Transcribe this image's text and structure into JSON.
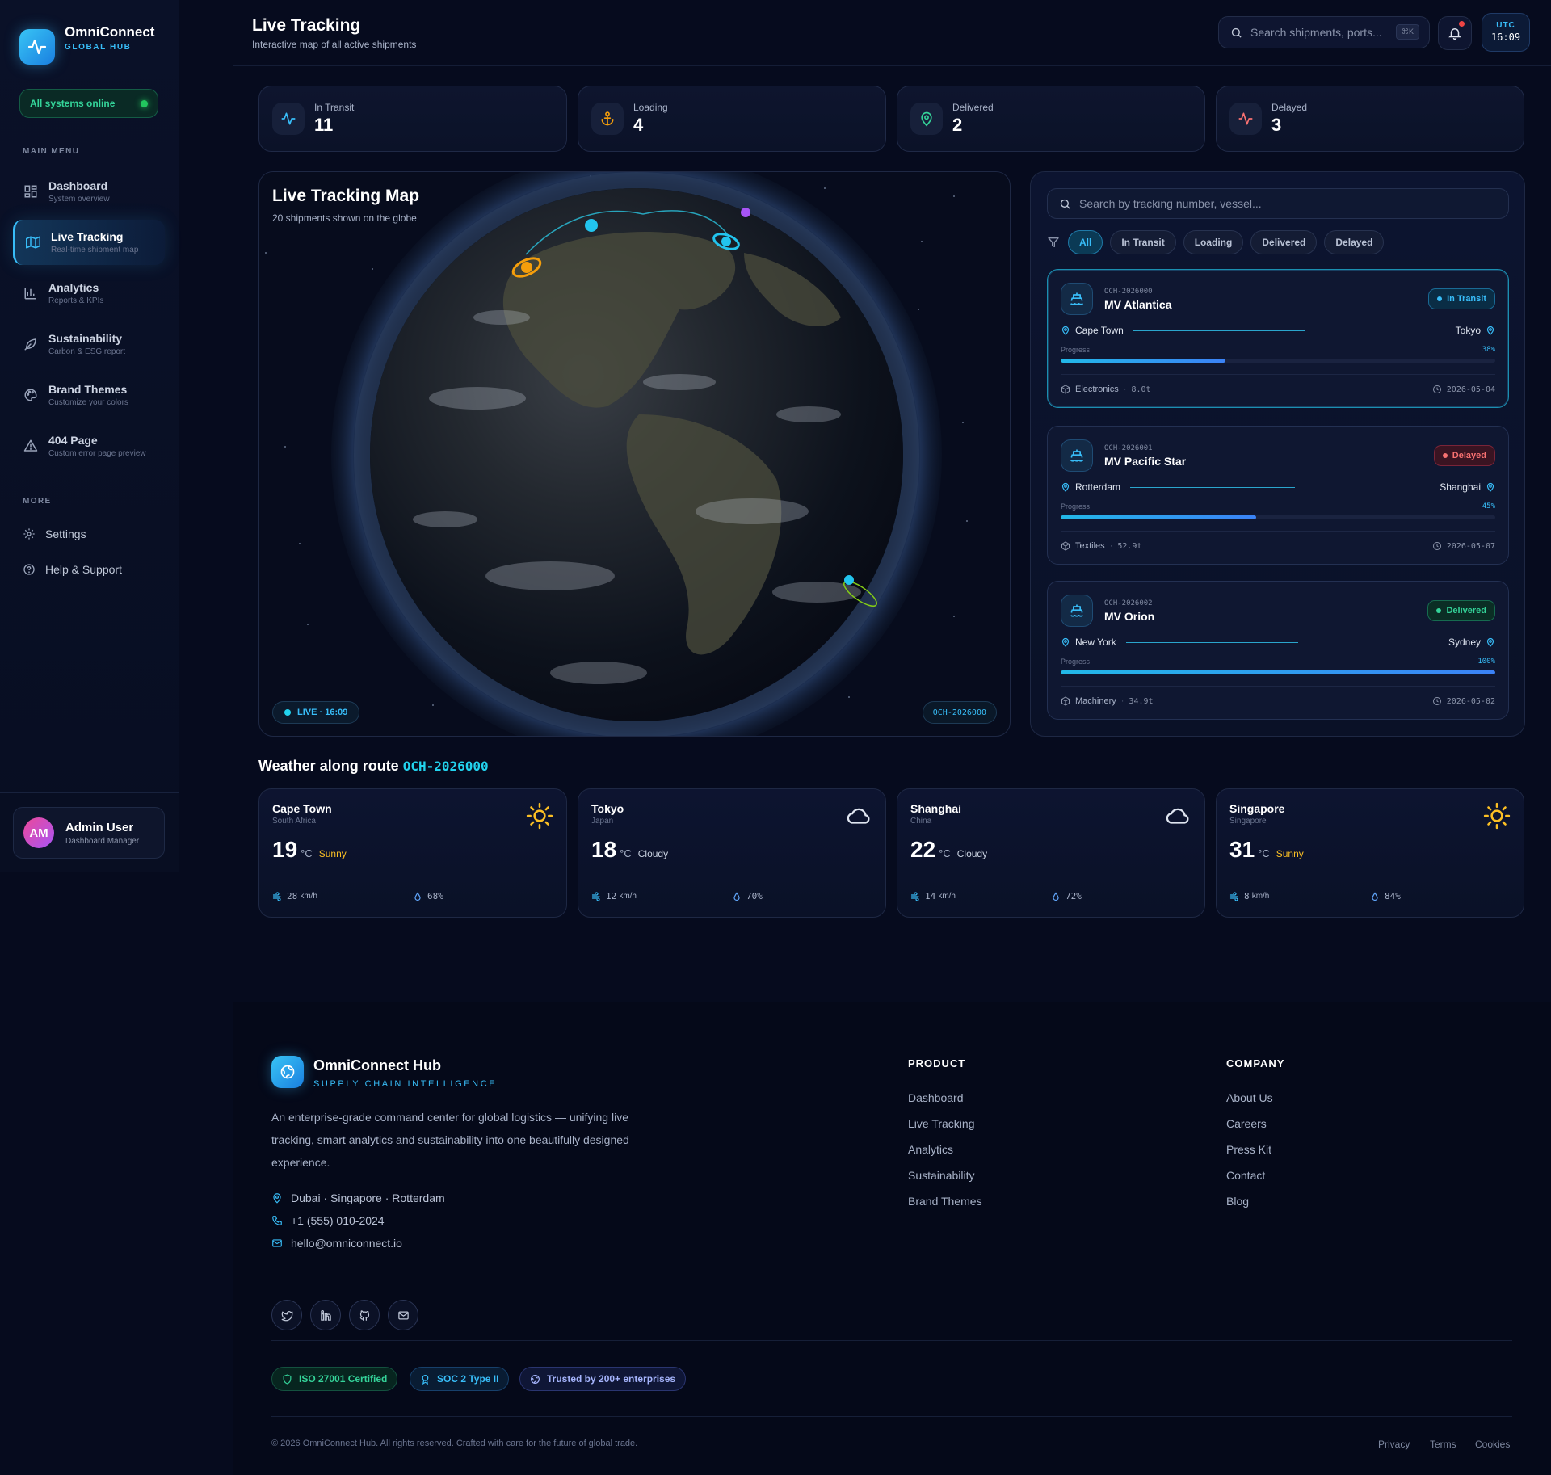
{
  "brand": {
    "name": "OmniConnect",
    "subtitle": "GLOBAL HUB",
    "status": "All systems online"
  },
  "sidebar": {
    "main_heading": "MAIN MENU",
    "items": [
      {
        "label": "Dashboard",
        "sub": "System overview",
        "icon": "grid-icon"
      },
      {
        "label": "Live Tracking",
        "sub": "Real-time shipment map",
        "icon": "map-icon",
        "active": true
      },
      {
        "label": "Analytics",
        "sub": "Reports & KPIs",
        "icon": "bar-chart-icon"
      },
      {
        "label": "Sustainability",
        "sub": "Carbon & ESG report",
        "icon": "leaf-icon"
      },
      {
        "label": "Brand Themes",
        "sub": "Customize your colors",
        "icon": "palette-icon"
      },
      {
        "label": "404 Page",
        "sub": "Custom error page preview",
        "icon": "warning-icon"
      }
    ],
    "more_heading": "MORE",
    "more_items": [
      {
        "label": "Settings",
        "icon": "gear-icon"
      },
      {
        "label": "Help & Support",
        "icon": "help-icon"
      }
    ],
    "user": {
      "initials": "AM",
      "name": "Admin User",
      "role": "Dashboard Manager"
    }
  },
  "header": {
    "title": "Live Tracking",
    "subtitle": "Interactive map of all active shipments",
    "search_placeholder": "Search shipments, ports...",
    "shortcut": "⌘K",
    "utc_label": "UTC",
    "utc_time": "16:09"
  },
  "stats": [
    {
      "label": "In Transit",
      "value": "11",
      "icon": "pulse-icon",
      "color": "#38bdf8"
    },
    {
      "label": "Loading",
      "value": "4",
      "icon": "anchor-icon",
      "color": "#f59e0b"
    },
    {
      "label": "Delivered",
      "value": "2",
      "icon": "pin-icon",
      "color": "#34d399"
    },
    {
      "label": "Delayed",
      "value": "3",
      "icon": "pulse-icon",
      "color": "#f87171"
    }
  ],
  "map": {
    "title": "Live Tracking Map",
    "subtitle": "20 shipments shown on the globe",
    "live_label": "LIVE · 16:09",
    "selected_tracking": "OCH-2026000"
  },
  "shipments": {
    "search_placeholder": "Search by tracking number, vessel...",
    "filters": [
      "All",
      "In Transit",
      "Loading",
      "Delivered",
      "Delayed"
    ],
    "progress_label": "Progress",
    "items": [
      {
        "id": "OCH-2026000",
        "vessel": "MV Atlantica",
        "status": "In Transit",
        "origin": "Cape Town",
        "destination": "Tokyo",
        "progress": 38,
        "progress_text": "38%",
        "cargo": "Electronics",
        "weight": "8.0t",
        "eta": "2026-05-04"
      },
      {
        "id": "OCH-2026001",
        "vessel": "MV Pacific Star",
        "status": "Delayed",
        "origin": "Rotterdam",
        "destination": "Shanghai",
        "progress": 45,
        "progress_text": "45%",
        "cargo": "Textiles",
        "weight": "52.9t",
        "eta": "2026-05-07"
      },
      {
        "id": "OCH-2026002",
        "vessel": "MV Orion",
        "status": "Delivered",
        "origin": "New York",
        "destination": "Sydney",
        "progress": 100,
        "progress_text": "100%",
        "cargo": "Machinery",
        "weight": "34.9t",
        "eta": "2026-05-02"
      }
    ]
  },
  "weather": {
    "title": "Weather along route",
    "tracking": "OCH-2026000",
    "speed_unit": "km/h",
    "temp_unit": "°C",
    "cities": [
      {
        "city": "Cape Town",
        "country": "South Africa",
        "temp": "19",
        "condition": "Sunny",
        "wind": "28",
        "humidity": "68%",
        "icon": "sun-icon"
      },
      {
        "city": "Tokyo",
        "country": "Japan",
        "temp": "18",
        "condition": "Cloudy",
        "wind": "12",
        "humidity": "70%",
        "icon": "cloud-icon"
      },
      {
        "city": "Shanghai",
        "country": "China",
        "temp": "22",
        "condition": "Cloudy",
        "wind": "14",
        "humidity": "72%",
        "icon": "cloud-icon"
      },
      {
        "city": "Singapore",
        "country": "Singapore",
        "temp": "31",
        "condition": "Sunny",
        "wind": "8",
        "humidity": "84%",
        "icon": "sun-icon"
      }
    ]
  },
  "footer": {
    "name": "OmniConnect Hub",
    "tagline": "SUPPLY CHAIN INTELLIGENCE",
    "description": "An enterprise-grade command center for global logistics — unifying live tracking, smart analytics and sustainability into one beautifully designed experience.",
    "location": "Dubai · Singapore · Rotterdam",
    "phone": "+1 (555) 010-2024",
    "email": "hello@omniconnect.io",
    "product_heading": "PRODUCT",
    "product_links": [
      "Dashboard",
      "Live Tracking",
      "Analytics",
      "Sustainability",
      "Brand Themes"
    ],
    "company_heading": "COMPANY",
    "company_links": [
      "About Us",
      "Careers",
      "Press Kit",
      "Contact",
      "Blog"
    ],
    "certs": [
      "ISO 27001 Certified",
      "SOC 2 Type II",
      "Trusted by 200+ enterprises"
    ],
    "copyright": "© 2026 OmniConnect Hub. All rights reserved. Crafted with care for the future of global trade.",
    "legal": [
      "Privacy",
      "Terms",
      "Cookies"
    ]
  }
}
